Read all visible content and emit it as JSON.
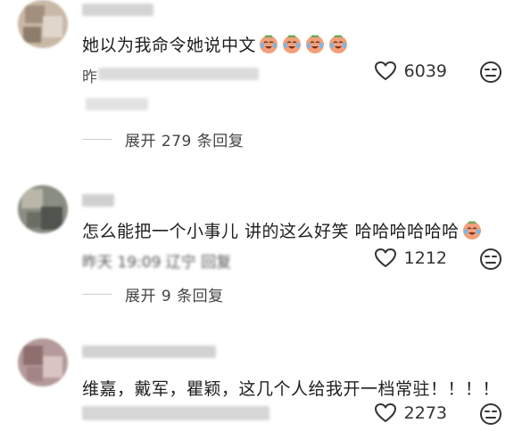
{
  "comments": [
    {
      "text": "她以为我命令她说中文",
      "emoji_count": 4,
      "emoji": "crying-laughing-face",
      "likes": "6039",
      "reply_label": "展开 279 条回复",
      "meta_visible": "昨"
    },
    {
      "text": "怎么能把一个小事儿 讲的这么好笑 哈哈哈哈哈哈",
      "emoji_count": 1,
      "emoji": "crying-laughing-face",
      "likes": "1212",
      "reply_label": "展开 9 条回复",
      "meta_visible": "昨天 19:09 辽宁 回复"
    },
    {
      "text": "维嘉，戴军，瞿颖，这几个人给我开一档常驻！！！！",
      "emoji_count": 0,
      "emoji": "",
      "likes": "2273",
      "reply_label": "",
      "meta_visible": ""
    }
  ],
  "colors": {
    "text": "#1e1e1e",
    "secondary": "#444444",
    "icon_stroke": "#333333",
    "divider": "#cfcfcf"
  }
}
